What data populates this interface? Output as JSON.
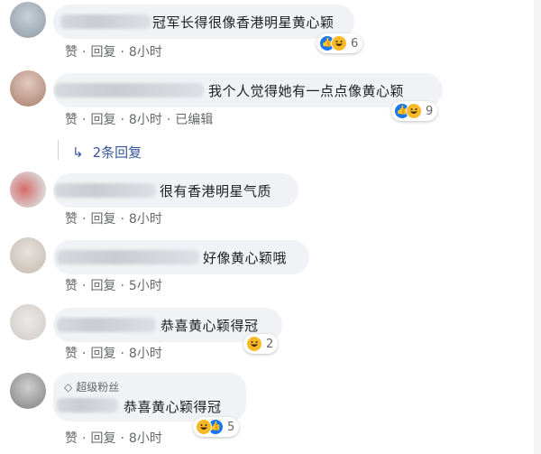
{
  "comments": [
    {
      "text": "冠军长得很像香港明星黄心颖",
      "actions": {
        "like": "赞",
        "reply": "回复",
        "time": "8小时"
      },
      "reactions": {
        "count": "6",
        "types": [
          "like",
          "haha"
        ]
      }
    },
    {
      "text": "我个人觉得她有一点点像黄心颖",
      "actions": {
        "like": "赞",
        "reply": "回复",
        "time": "8小时",
        "edited": "已编辑"
      },
      "reactions": {
        "count": "9",
        "types": [
          "like",
          "haha"
        ]
      },
      "replies": {
        "label": "2条回复"
      }
    },
    {
      "text": "很有香港明星气质",
      "actions": {
        "like": "赞",
        "reply": "回复",
        "time": "8小时"
      }
    },
    {
      "text": "好像黄心颖哦",
      "actions": {
        "like": "赞",
        "reply": "回复",
        "time": "5小时"
      }
    },
    {
      "text": "恭喜黄心颖得冠",
      "actions": {
        "like": "赞",
        "reply": "回复",
        "time": "8小时"
      },
      "reactions": {
        "count": "2",
        "types": [
          "haha"
        ]
      }
    },
    {
      "badge": "超级粉丝",
      "text": "恭喜黄心颖得冠",
      "actions": {
        "like": "赞",
        "reply": "回复",
        "time": "8小时"
      },
      "reactions": {
        "count": "5",
        "types": [
          "haha",
          "like"
        ]
      }
    }
  ],
  "colors": {
    "bubble": "#f0f2f5",
    "action_text": "#65676b",
    "link": "#385898",
    "like_blue": "#1877f2",
    "haha_yellow": "#f7b928"
  }
}
